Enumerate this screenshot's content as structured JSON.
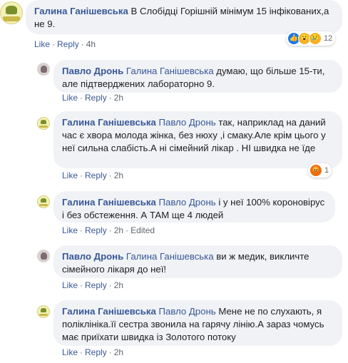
{
  "comments": [
    {
      "author": "Галина Ганішевська",
      "tag": "",
      "text": "В Слобідці Горішній мінімум 15 інфікованих,а не 9.",
      "actions": {
        "like": "Like",
        "reply": "Reply",
        "time": "4h",
        "edited": ""
      },
      "reactions": {
        "icons": [
          "like-icon",
          "wow-icon",
          "sad-icon"
        ],
        "count": "12"
      }
    },
    {
      "author": "Павло Дронь",
      "tag": "Галина Ганішевська",
      "text": "думаю, що більше 15-ти, але підтверджених лабораторно 9.",
      "actions": {
        "like": "Like",
        "reply": "Reply",
        "time": "2h",
        "edited": ""
      }
    },
    {
      "author": "Галина Ганішевська",
      "tag": "Павло Дронь",
      "text": "так, наприклад на даний час є хвора молода жінка, без нюху ,і смаку.Але крім цього у неї сильна слабість.А ні сімейний лікар . НІ швидка не їде",
      "actions": {
        "like": "Like",
        "reply": "Reply",
        "time": "2h",
        "edited": ""
      },
      "reactions": {
        "icons": [
          "angry-icon"
        ],
        "count": "1"
      }
    },
    {
      "author": "Галина Ганішевська",
      "tag": "Павло Дронь",
      "text": "і у неї 100% короновірус і без обстеження. А ТАМ ще 4 людей",
      "actions": {
        "like": "Like",
        "reply": "Reply",
        "time": "2h",
        "edited": "Edited"
      }
    },
    {
      "author": "Павло Дронь",
      "tag": "Галина Ганішевська",
      "text": "ви ж медик, викличте сімейного лікаря до неї!",
      "actions": {
        "like": "Like",
        "reply": "Reply",
        "time": "2h",
        "edited": ""
      }
    },
    {
      "author": "Галина Ганішевська",
      "tag": "Павло Дронь",
      "text": "Мене не по слухають, я поліклініка.її сестра звонила на гарячу лінію.А зараз чомусь має приїхати швидка із Золотого потоку",
      "actions": {
        "like": "Like",
        "reply": "Reply",
        "time": "2h",
        "edited": ""
      }
    }
  ],
  "colors": {
    "link": "#385898",
    "bubble": "#f0f2f5",
    "meta": "#606770",
    "like": "#1877f2",
    "angry": "#e9710f"
  }
}
